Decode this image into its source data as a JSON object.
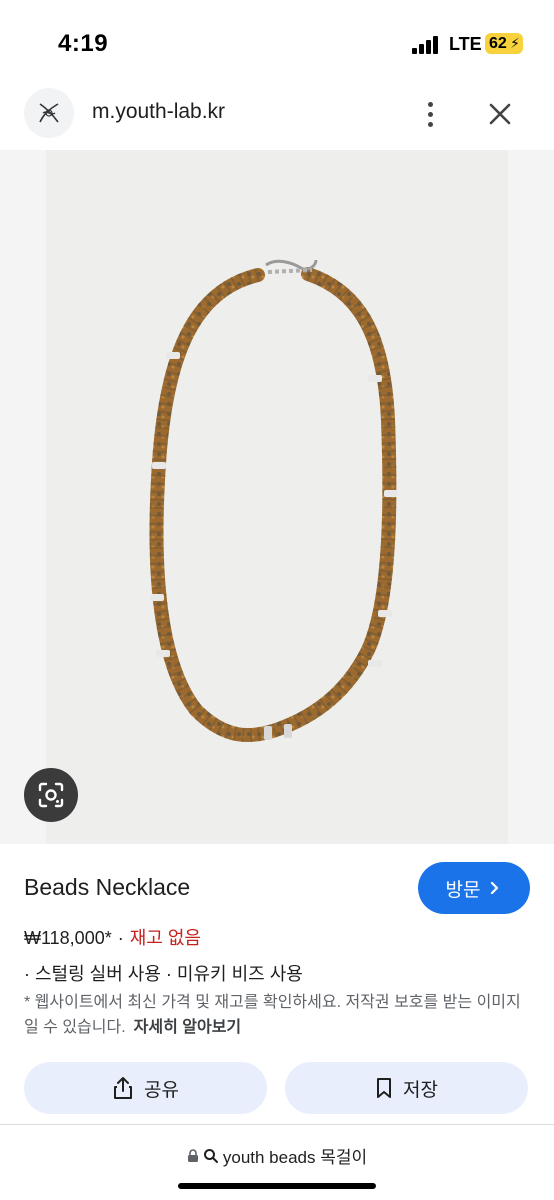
{
  "status_bar": {
    "time": "4:19",
    "network": "LTE",
    "battery": "62"
  },
  "browser": {
    "url": "m.youth-lab.kr"
  },
  "product": {
    "title": "Beads Necklace",
    "visit_label": "방문",
    "price": "₩118,000*",
    "separator": "·",
    "stock_status": "재고 없음",
    "features": "· 스털링 실버 사용 · 미유키 비즈 사용",
    "disclaimer": "* 웹사이트에서 최신 가격 및 재고를 확인하세요. 저작권 보호를 받는 이미지일 수 있습니다.",
    "learn_more": "자세히 알아보기"
  },
  "actions": {
    "share_label": "공유",
    "save_label": "저장"
  },
  "search": {
    "query": "youth beads 목걸이"
  },
  "colors": {
    "accent": "#1a73e8",
    "stock_out": "#c5221f",
    "action_bg": "#e8eefc"
  },
  "icons": [
    "signal-icon",
    "site-logo-icon",
    "more-vert-icon",
    "close-icon",
    "lens-icon",
    "chevron-right-icon",
    "share-icon",
    "bookmark-icon",
    "lock-icon",
    "search-icon"
  ]
}
